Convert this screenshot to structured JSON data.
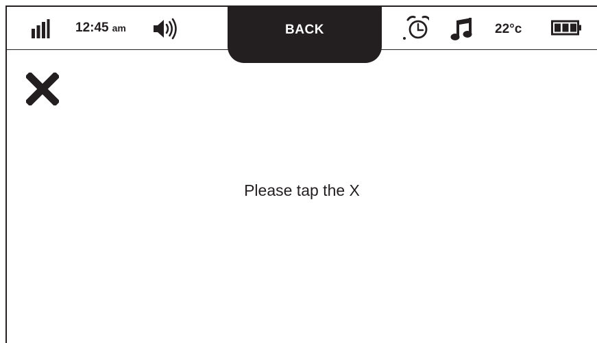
{
  "status_bar": {
    "signal_icon": "signal-bars-icon",
    "time": "12:45",
    "ampm": "am",
    "volume_icon": "speaker-volume-icon",
    "alarm_icon": "alarm-clock-icon",
    "music_icon": "music-note-icon",
    "temperature": "22°c",
    "battery_icon": "battery-full-icon"
  },
  "back_button": {
    "label": "BACK"
  },
  "close_icon": "close-x-icon",
  "main": {
    "prompt": "Please tap the X"
  },
  "colors": {
    "ink": "#231f20",
    "background": "#ffffff"
  }
}
